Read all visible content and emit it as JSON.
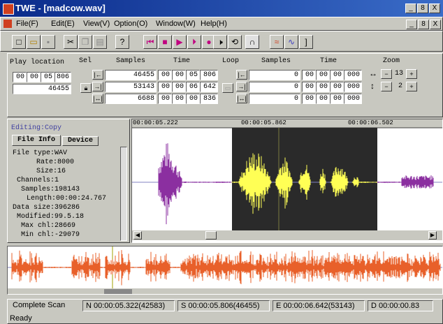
{
  "window": {
    "title": "TWE - [madcow.wav]",
    "min": "_",
    "max": "8",
    "close": "X"
  },
  "menu": {
    "items": [
      "File(F)",
      "Edit(E)",
      "View(V)",
      "Option(O)",
      "Window(W)",
      "Help(H)"
    ],
    "doc_min": "_",
    "doc_max": "8",
    "doc_close": "X"
  },
  "toolbar": {
    "icons": [
      "new-icon",
      "open-icon",
      "save-icon",
      "cut-icon",
      "copy-icon",
      "paste-icon",
      "help-icon",
      "rewind-icon",
      "stop-icon",
      "play-icon",
      "step-icon",
      "record-icon",
      "mute-icon",
      "loop-icon",
      "headphone-icon",
      "wave-icon",
      "edit-wave-icon",
      "marker-icon"
    ]
  },
  "play": {
    "label": "Play location",
    "cells": [
      "00",
      "00",
      "05",
      "806"
    ],
    "samples": "46455"
  },
  "sel": {
    "label": "Sel",
    "samples_label": "Samples",
    "time_label": "Time",
    "rows": [
      {
        "samples": "46455",
        "time": [
          "00",
          "00",
          "05",
          "806"
        ]
      },
      {
        "samples": "53143",
        "time": [
          "00",
          "00",
          "06",
          "642"
        ]
      },
      {
        "samples": "6688",
        "time": [
          "00",
          "00",
          "00",
          "836"
        ]
      }
    ]
  },
  "loop": {
    "label": "Loop",
    "samples_label": "Samples",
    "time_label": "Time",
    "rows": [
      {
        "samples": "0",
        "time": [
          "00",
          "00",
          "00",
          "000"
        ]
      },
      {
        "samples": "0",
        "time": [
          "00",
          "00",
          "00",
          "000"
        ]
      },
      {
        "samples": "0",
        "time": [
          "00",
          "00",
          "00",
          "000"
        ]
      }
    ]
  },
  "zoom": {
    "label": "Zoom",
    "h_value": "13",
    "v_value": "2"
  },
  "info": {
    "editing": "Editing:Copy",
    "tabs": [
      "File Info",
      "Device"
    ],
    "lines": [
      "File type:WAV",
      "Rate:8000",
      "Size:16",
      "Channels:1",
      "Samples:198143",
      "Length:00:00:24.767",
      "Data size:396286",
      "Modified:99.5.18",
      "Max chl:28669",
      "Min chl:-29079"
    ]
  },
  "ruler": {
    "ticks": [
      "00:00:05.222",
      "00:00:05.862",
      "00:00:06.502"
    ]
  },
  "colors": {
    "wave_purple": "#8b2fa0",
    "wave_yellow": "#ffff55",
    "wave_orange": "#e8602a",
    "selection_bg": "#2a2a2a"
  },
  "status": {
    "scan": "Complete Scan",
    "n": "N 00:00:05.322(42583)",
    "s": "S 00:00:05.806(46455)",
    "e": "E 00:00:06.642(53143)",
    "d": "D 00:00:00.83",
    "ready": "Ready"
  }
}
